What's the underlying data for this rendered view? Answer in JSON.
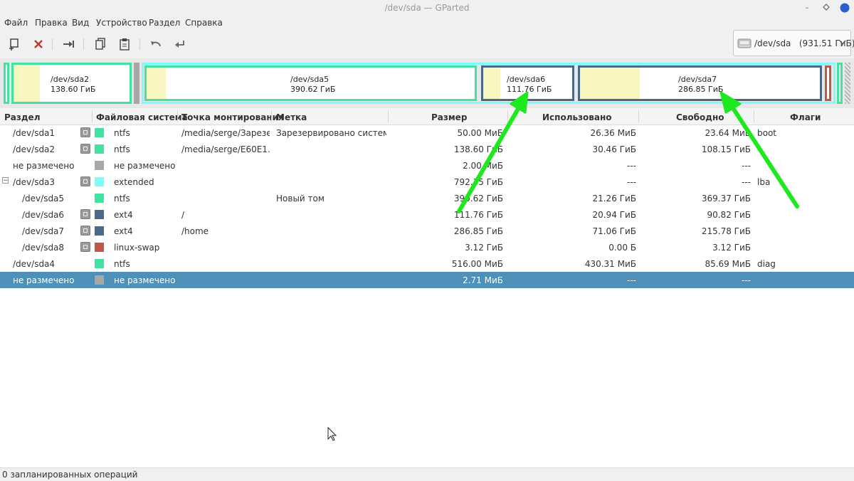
{
  "window": {
    "title": "/dev/sda — GParted"
  },
  "menu": {
    "file": "Файл",
    "edit": "Правка",
    "view": "Вид",
    "device": "Устройство",
    "partition": "Раздел",
    "help": "Справка"
  },
  "toolbar": {
    "icons": [
      "new-partition-icon",
      "delete-icon",
      "resize-move-icon",
      "copy-icon",
      "paste-icon",
      "undo-icon",
      "apply-icon"
    ]
  },
  "device_selector": {
    "name": "/dev/sda",
    "size": "(931.51 ГиБ)"
  },
  "diskmap": {
    "sda2": {
      "name": "/dev/sda2",
      "size": "138.60 ГиБ"
    },
    "sda5": {
      "name": "/dev/sda5",
      "size": "390.62 ГиБ"
    },
    "sda6": {
      "name": "/dev/sda6",
      "size": "111.76 ГиБ"
    },
    "sda7": {
      "name": "/dev/sda7",
      "size": "286.85 ГиБ"
    }
  },
  "colors": {
    "ntfs": "#42e3a0",
    "extended": "#7dfcfc",
    "ext4": "#4a6888",
    "linux_swap": "#c0584a",
    "unallocated": "#a8a8a8",
    "selection": "#4f90b8",
    "used": "#f7f5c0",
    "arrow": "#1ee81e"
  },
  "table": {
    "columns": {
      "partition": "Раздел",
      "filesystem": "Файловая система",
      "mountpoint": "Точка монтирования",
      "label": "Метка",
      "size": "Размер",
      "used": "Использовано",
      "unused": "Свободно",
      "flags": "Флаги"
    },
    "rows": [
      {
        "partition": "/dev/sda1",
        "fs": "ntfs",
        "mount": "/media/serge/Зарезе…",
        "label": "Зарезервировано системой",
        "size": "50.00 МиБ",
        "used": "26.36 МиБ",
        "unused": "23.64 МиБ",
        "flags": "boot"
      },
      {
        "partition": "/dev/sda2",
        "fs": "ntfs",
        "mount": "/media/serge/E60E1…",
        "label": "",
        "size": "138.60 ГиБ",
        "used": "30.46 ГиБ",
        "unused": "108.15 ГиБ",
        "flags": ""
      },
      {
        "partition": "не размечено",
        "fs": "не размечено",
        "mount": "",
        "label": "",
        "size": "2.00 МиБ",
        "used": "---",
        "unused": "---",
        "flags": ""
      },
      {
        "partition": "/dev/sda3",
        "fs": "extended",
        "mount": "",
        "label": "",
        "size": "792.35 ГиБ",
        "used": "---",
        "unused": "---",
        "flags": "lba"
      },
      {
        "partition": "/dev/sda5",
        "fs": "ntfs",
        "mount": "",
        "label": "Новый том",
        "size": "390.62 ГиБ",
        "used": "21.26 ГиБ",
        "unused": "369.37 ГиБ",
        "flags": ""
      },
      {
        "partition": "/dev/sda6",
        "fs": "ext4",
        "mount": "/",
        "label": "",
        "size": "111.76 ГиБ",
        "used": "20.94 ГиБ",
        "unused": "90.82 ГиБ",
        "flags": ""
      },
      {
        "partition": "/dev/sda7",
        "fs": "ext4",
        "mount": "/home",
        "label": "",
        "size": "286.85 ГиБ",
        "used": "71.06 ГиБ",
        "unused": "215.78 ГиБ",
        "flags": ""
      },
      {
        "partition": "/dev/sda8",
        "fs": "linux-swap",
        "mount": "",
        "label": "",
        "size": "3.12 ГиБ",
        "used": "0.00 Б",
        "unused": "3.12 ГиБ",
        "flags": ""
      },
      {
        "partition": "/dev/sda4",
        "fs": "ntfs",
        "mount": "",
        "label": "",
        "size": "516.00 МиБ",
        "used": "430.31 МиБ",
        "unused": "85.69 МиБ",
        "flags": "diag"
      },
      {
        "partition": "не размечено",
        "fs": "не размечено",
        "mount": "",
        "label": "",
        "size": "2.71 МиБ",
        "used": "---",
        "unused": "---",
        "flags": ""
      }
    ]
  },
  "status": {
    "text": "0 запланированных операций"
  }
}
